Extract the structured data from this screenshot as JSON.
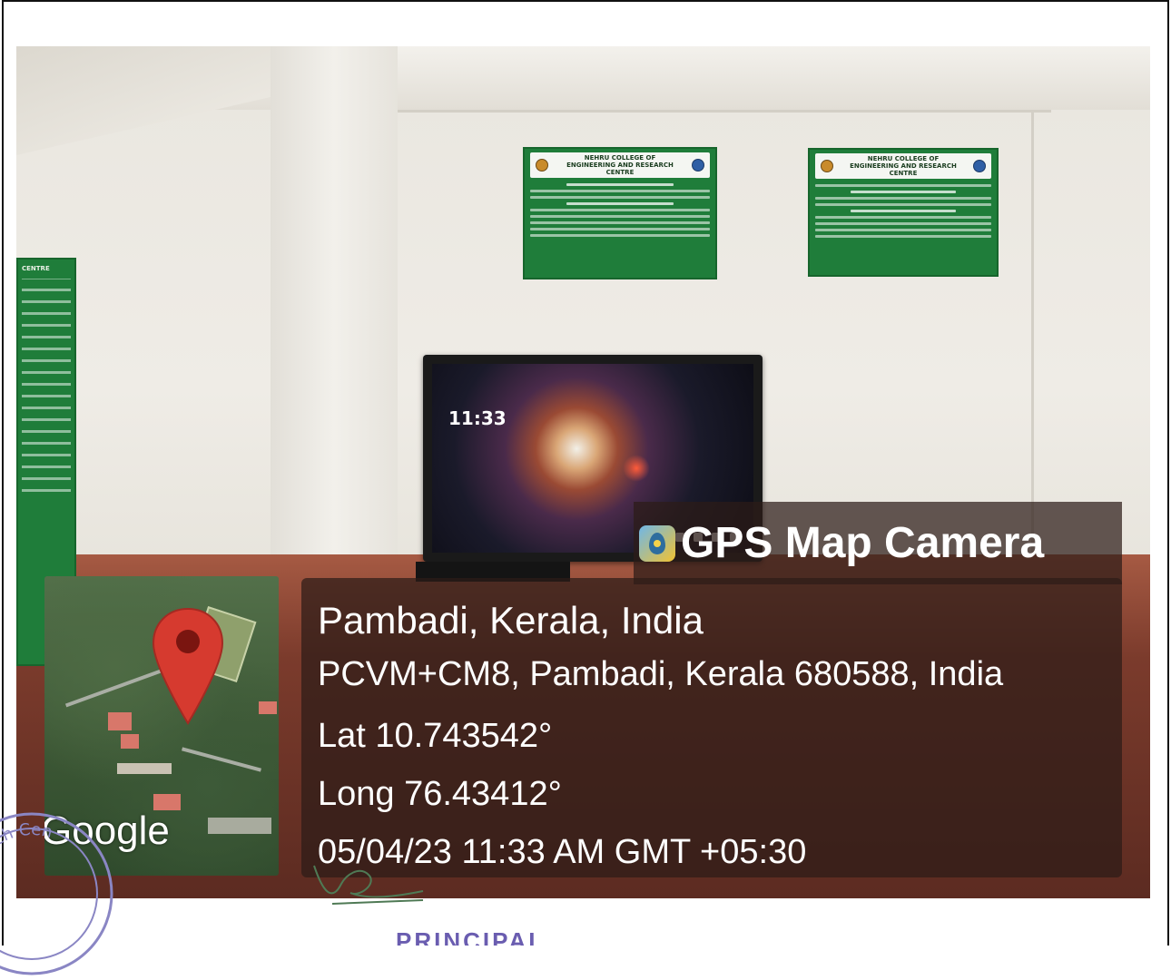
{
  "overlay": {
    "app_name": "GPS Map Camera",
    "place": "Pambadi, Kerala, India",
    "address": "PCVM+CM8, Pambadi, Kerala 680588, India",
    "latitude": "Lat 10.743542°",
    "longitude": "Long 76.43412°",
    "datetime": "05/04/23 11:33 AM GMT +05:30"
  },
  "minimap": {
    "provider_label": "Google",
    "pin_color": "#d63a2f"
  },
  "tv": {
    "clock": "11:33"
  },
  "posters": {
    "center_title": "NEHRU COLLEGE OF ENGINEERING AND RESEARCH CENTRE",
    "right_title": "NEHRU COLLEGE OF ENGINEERING AND RESEARCH CENTRE",
    "left_title": "CENTRE"
  },
  "stamp": {
    "text": "Research Cen"
  },
  "footer": {
    "signature_label": "PRINCIPAL"
  },
  "colors": {
    "poster_green": "#1f7d3a",
    "overlay_bg": "#2d1c18"
  }
}
